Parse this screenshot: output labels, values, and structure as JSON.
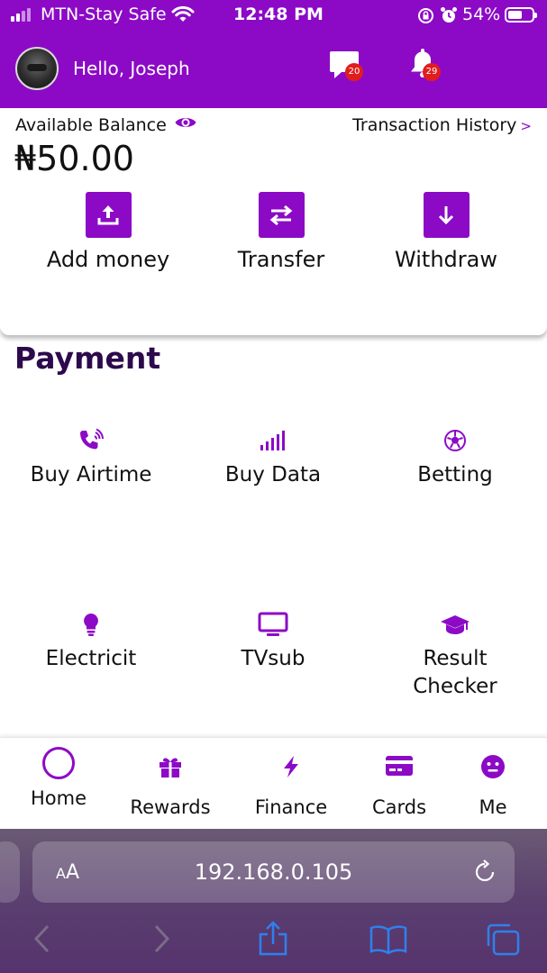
{
  "status_bar": {
    "carrier": "MTN-Stay Safe",
    "time": "12:48 PM",
    "battery": "54%",
    "battery_level": 0.54
  },
  "header": {
    "greeting": "Hello, Joseph",
    "messages_badge": "20",
    "notifications_badge": "29",
    "icons": [
      "chat-icon",
      "bell-icon"
    ]
  },
  "balance_card": {
    "label": "Available Balance",
    "amount": "₦50.00",
    "history_link": "Transaction History",
    "history_chevron": ">",
    "actions": [
      {
        "label": "Add money",
        "icon": "upload-icon"
      },
      {
        "label": "Transfer",
        "icon": "transfer-icon"
      },
      {
        "label": "Withdraw",
        "icon": "download-icon"
      }
    ]
  },
  "payment": {
    "title": "Payment",
    "services": [
      {
        "label": "Buy Airtime",
        "icon": "phone-ringing-icon"
      },
      {
        "label": "Buy Data",
        "icon": "signal-bars-icon"
      },
      {
        "label": "Betting",
        "icon": "soccer-ball-icon"
      },
      {
        "label": "Electricit",
        "icon": "lightbulb-icon"
      },
      {
        "label": "TVsub",
        "icon": "tv-icon"
      },
      {
        "label": "Result Checker",
        "icon": "graduation-cap-icon"
      }
    ]
  },
  "bottom_nav": {
    "items": [
      {
        "label": "Home",
        "icon": "home-circle-icon",
        "active": true
      },
      {
        "label": "Rewards",
        "icon": "gift-icon"
      },
      {
        "label": "Finance",
        "icon": "bolt-icon"
      },
      {
        "label": "Cards",
        "icon": "credit-card-icon"
      },
      {
        "label": "Me",
        "icon": "smiley-icon"
      }
    ]
  },
  "browser": {
    "text_size_label": "AA",
    "url": "192.168.0.105"
  },
  "colors": {
    "accent": "#8c0ac6",
    "title": "#2d0a4b",
    "badge": "#e11d1d",
    "browser_blue": "#2f80ed"
  }
}
